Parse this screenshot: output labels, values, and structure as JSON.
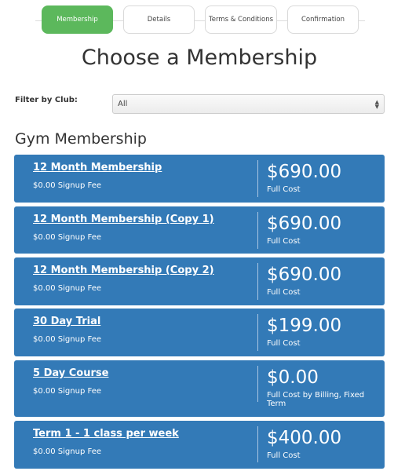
{
  "steps": [
    {
      "label": "Membership",
      "active": true
    },
    {
      "label": "Details",
      "active": false
    },
    {
      "label": "Terms & Conditions",
      "active": false
    },
    {
      "label": "Confirmation",
      "active": false
    }
  ],
  "page_title": "Choose a Membership",
  "filter": {
    "label": "Filter by Club:",
    "selected": "All"
  },
  "section_title": "Gym Membership",
  "memberships": [
    {
      "name": "12 Month Membership",
      "signup_fee": "$0.00 Signup Fee",
      "price": "$690.00",
      "cost_label": "Full Cost"
    },
    {
      "name": "12 Month Membership (Copy 1)",
      "signup_fee": "$0.00 Signup Fee",
      "price": "$690.00",
      "cost_label": "Full Cost"
    },
    {
      "name": "12 Month Membership (Copy 2)",
      "signup_fee": "$0.00 Signup Fee",
      "price": "$690.00",
      "cost_label": "Full Cost"
    },
    {
      "name": "30 Day Trial",
      "signup_fee": "$0.00 Signup Fee",
      "price": "$199.00",
      "cost_label": "Full Cost"
    },
    {
      "name": "5 Day Course",
      "signup_fee": "$0.00 Signup Fee",
      "price": "$0.00",
      "cost_label": "Full Cost by Billing, Fixed Term"
    },
    {
      "name": "Term 1 - 1 class per week",
      "signup_fee": "$0.00 Signup Fee",
      "price": "$400.00",
      "cost_label": "Full Cost"
    }
  ],
  "colors": {
    "active_step": "#5cb85c",
    "card": "#337ab7"
  }
}
